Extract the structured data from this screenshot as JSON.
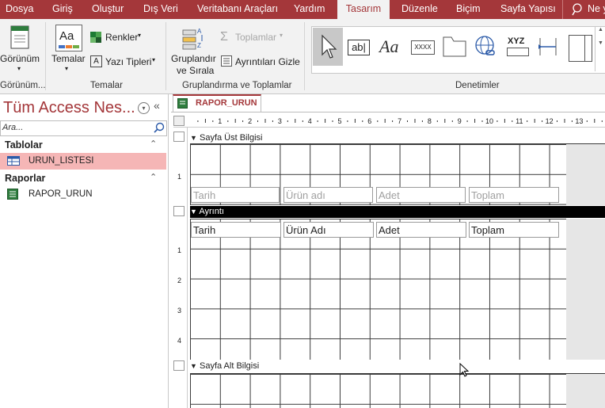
{
  "tabs": [
    "Dosya",
    "Giriş",
    "Oluştur",
    "Dış Veri",
    "Veritabanı Araçları",
    "Yardım",
    "Tasarım",
    "Düzenle",
    "Biçim",
    "Sayfa Yapısı",
    "Ne y"
  ],
  "ribbon": {
    "view_label": "Görünüm",
    "view_group": "Görünüm...",
    "themes_label": "Temalar",
    "colors_label": "Renkler",
    "fonts_label": "Yazı Tipleri",
    "themes_group": "Temalar",
    "group_sort_label_1": "Gruplandır",
    "group_sort_label_2": "ve Sırala",
    "totals_label": "Toplamlar",
    "hide_details_label": "Ayrıntıları Gizle",
    "grouping_group": "Gruplandırma ve Toplamlar",
    "controls_group": "Denetimler",
    "textbox_glyph": "ab|",
    "label_glyph": "Aa",
    "button_glyph": "XXXX",
    "xyz_glyph": "XYZ"
  },
  "nav": {
    "title": "Tüm Access Nes...",
    "search_placeholder": "Ara...",
    "sections": [
      {
        "label": "Tablolar",
        "items": [
          "URUN_LISTESI"
        ]
      },
      {
        "label": "Raporlar",
        "items": [
          "RAPOR_URUN"
        ]
      }
    ]
  },
  "document": {
    "tab_title": "RAPOR_URUN",
    "ruler_numbers": [
      "1",
      "2",
      "3",
      "4",
      "5",
      "6",
      "7",
      "8",
      "9",
      "10",
      "11",
      "12",
      "13"
    ],
    "sections": {
      "page_header": "Sayfa Üst Bilgisi",
      "detail": "Ayrıntı",
      "page_footer": "Sayfa Alt Bilgisi"
    },
    "header_labels": [
      "Tarih",
      "Ürün adı",
      "Adet",
      "Toplam"
    ],
    "detail_fields": [
      "Tarih",
      "Ürün Adı",
      "Adet",
      "Toplam"
    ],
    "vertical_ruler": {
      "header": [
        "1"
      ],
      "detail": [
        "1",
        "2",
        "3",
        "4"
      ]
    }
  },
  "colors": {
    "accent": "#a4373a",
    "selected_nav_item": "#f5b6b6",
    "detail_bar": "#000000"
  }
}
